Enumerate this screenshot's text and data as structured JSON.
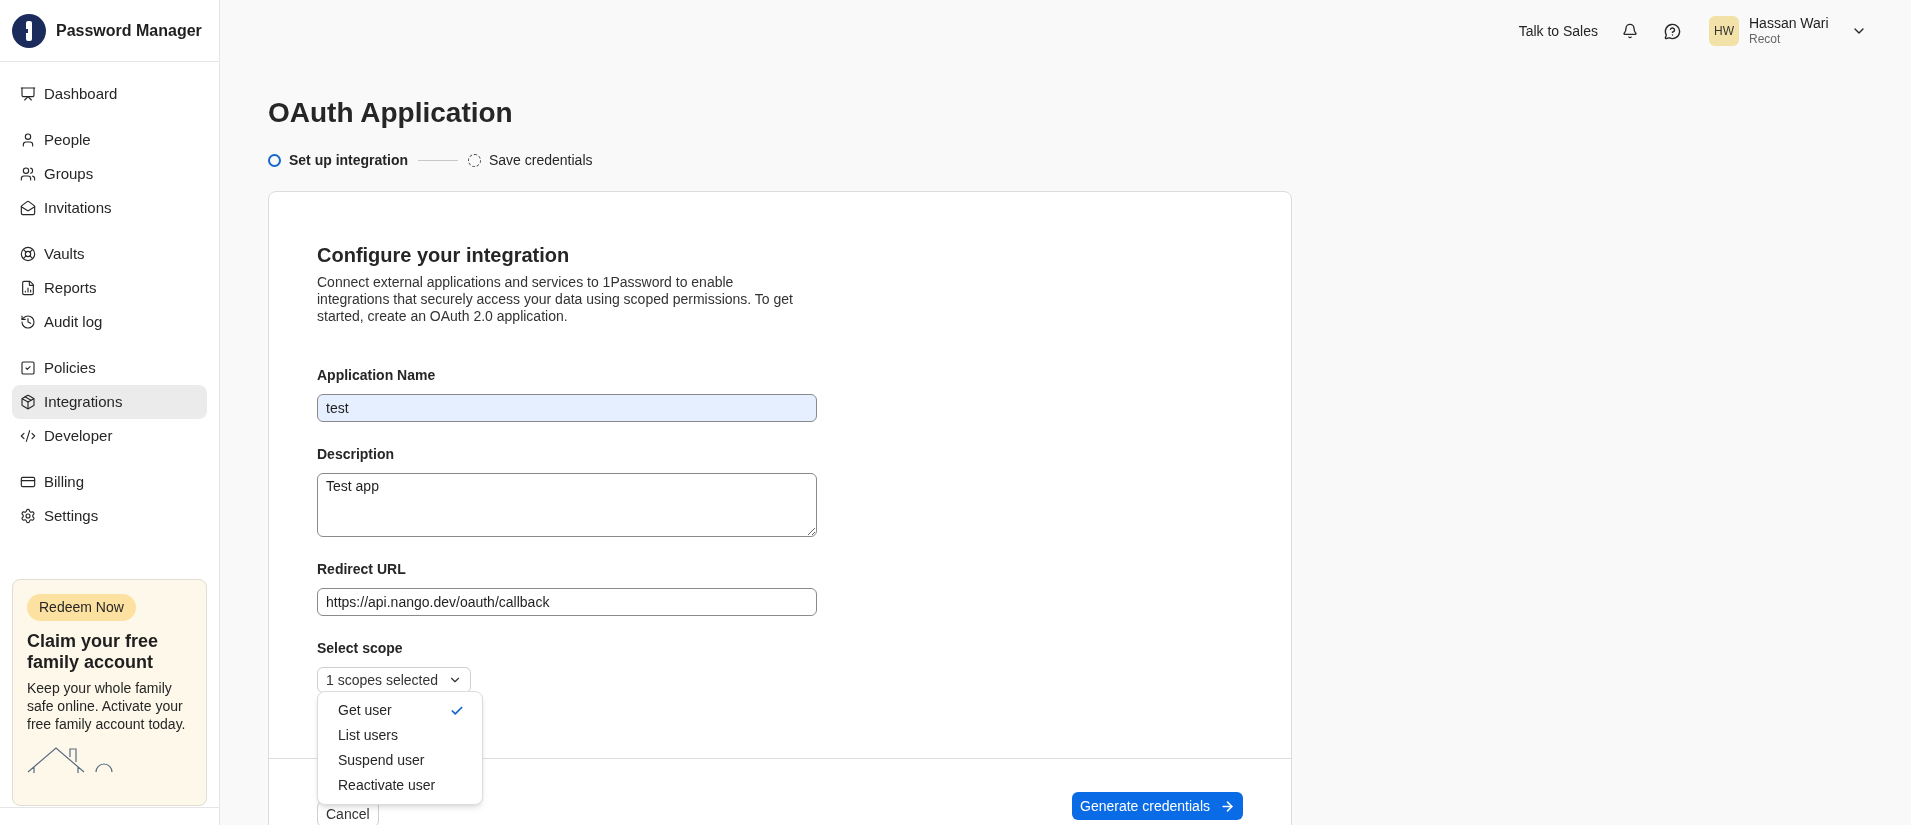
{
  "app": {
    "name": "Password Manager"
  },
  "nav": [
    [
      {
        "label": "Dashboard",
        "selected": false
      }
    ],
    [
      {
        "label": "People",
        "selected": false
      },
      {
        "label": "Groups",
        "selected": false
      },
      {
        "label": "Invitations",
        "selected": false
      }
    ],
    [
      {
        "label": "Vaults",
        "selected": false
      },
      {
        "label": "Reports",
        "selected": false
      },
      {
        "label": "Audit log",
        "selected": false
      }
    ],
    [
      {
        "label": "Policies",
        "selected": false
      },
      {
        "label": "Integrations",
        "selected": true
      },
      {
        "label": "Developer",
        "selected": false
      }
    ],
    [
      {
        "label": "Billing",
        "selected": false
      },
      {
        "label": "Settings",
        "selected": false
      }
    ]
  ],
  "promo": {
    "badge": "Redeem Now",
    "title": "Claim your free family account",
    "text": "Keep your whole family safe online. Activate your free family account today."
  },
  "header": {
    "sales_link": "Talk to Sales",
    "user": {
      "initials": "HW",
      "name": "Hassan Wari",
      "org": "Recot"
    }
  },
  "page": {
    "title": "OAuth Application",
    "steps": [
      {
        "label": "Set up integration",
        "selected": true
      },
      {
        "label": "Save credentials",
        "selected": false
      }
    ]
  },
  "form": {
    "heading": "Configure your integration",
    "description": "Connect external applications and services to 1Password to enable integrations that securely access your data using scoped permissions. To get started, create an OAuth 2.0 application.",
    "fields": [
      {
        "kind": "input",
        "label": "Application Name",
        "value": "test",
        "focused": true
      },
      {
        "kind": "textarea",
        "label": "Description",
        "value": "Test app",
        "focused": false
      },
      {
        "kind": "input",
        "label": "Redirect URL",
        "value": "https://api.nango.dev/oauth/callback",
        "focused": false
      }
    ],
    "scope": {
      "label": "Select scope",
      "button": "1 scopes selected",
      "options": [
        {
          "label": "Get user",
          "checked": true
        },
        {
          "label": "List users",
          "checked": false
        },
        {
          "label": "Suspend user",
          "checked": false
        },
        {
          "label": "Reactivate user",
          "checked": false
        }
      ]
    }
  },
  "footer": {
    "cancel": "Cancel",
    "submit": "Generate credentials"
  }
}
